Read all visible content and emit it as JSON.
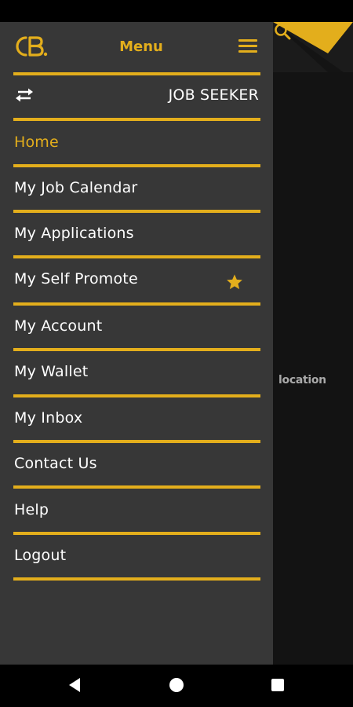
{
  "drawer": {
    "title": "Menu",
    "role": "JOB SEEKER",
    "items": [
      {
        "label": "Home",
        "active": true
      },
      {
        "label": "My Job Calendar"
      },
      {
        "label": "My Applications"
      },
      {
        "label": "My Self Promote",
        "icon": "star-icon"
      },
      {
        "label": "My Account"
      },
      {
        "label": "My Wallet"
      },
      {
        "label": "My Inbox"
      },
      {
        "label": "Contact Us"
      },
      {
        "label": "Help"
      },
      {
        "label": "Logout"
      }
    ]
  },
  "background": {
    "location_text": "location"
  },
  "icons": [
    "logo-icon",
    "hamburger-icon",
    "swap-icon",
    "star-icon",
    "search-icon",
    "back-icon",
    "home-icon",
    "recents-icon"
  ],
  "colors": {
    "accent": "#e3ae1c",
    "drawer_bg": "#373737",
    "screen_bg": "#131313",
    "text": "#ffffff"
  }
}
